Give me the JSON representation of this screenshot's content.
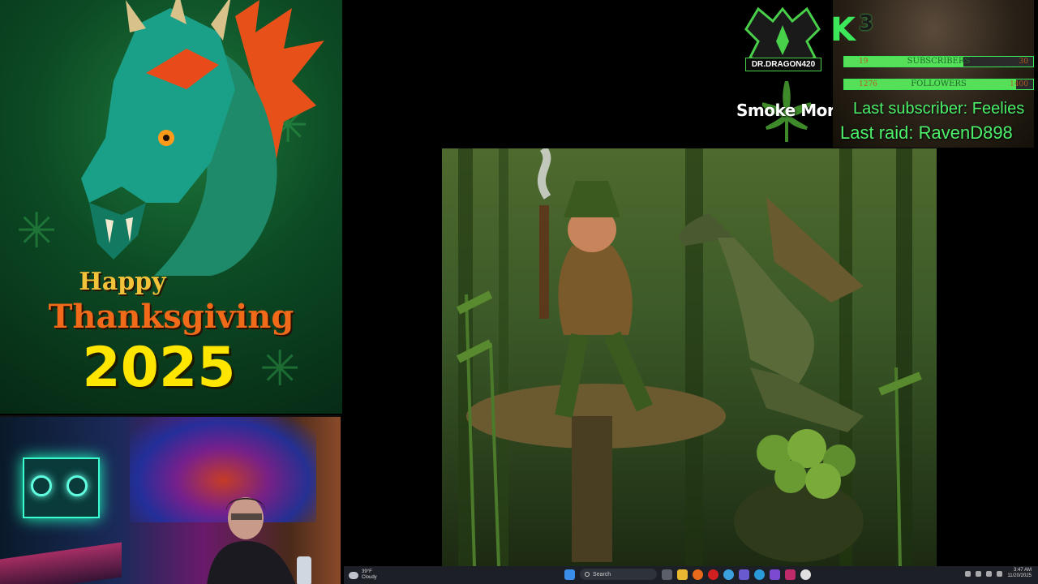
{
  "promo": {
    "line1": "Happy",
    "line2": "Thanksgiving",
    "line3": "2025"
  },
  "overlay": {
    "logo_text": "DR.DRAGON420",
    "smoke_text": "Smoke More",
    "badge_letter": "K",
    "badge_number": "3",
    "subscribers": {
      "label": "SUBSCRIBERS",
      "current": "19",
      "goal": "30",
      "fraction": 0.633
    },
    "followers": {
      "label": "FOLLOWERS",
      "current": "1276",
      "goal": "1400",
      "fraction": 0.911
    },
    "last_subscriber": "Last subscriber: Feelies",
    "last_raid": "Last raid: RavenD898"
  },
  "taskbar": {
    "weather_temp": "39°F",
    "weather_desc": "Cloudy",
    "search_placeholder": "Search",
    "time": "3:47 AM",
    "date": "11/20/2025"
  },
  "colors": {
    "accent_green": "#4cf06a",
    "promo_orange": "#f06a1a",
    "promo_yellow": "#ffe600"
  }
}
